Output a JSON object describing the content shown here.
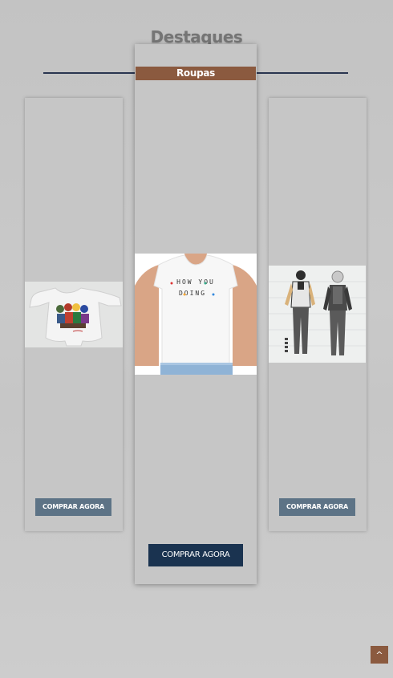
{
  "section": {
    "title": "Destaques",
    "category_tag": "Roupas"
  },
  "products": [
    {
      "position": "left",
      "image": "baby-bodysuit-with-cartoon-characters",
      "button_label": "COMPRAR AGORA"
    },
    {
      "position": "center",
      "image": "white-tshirt-how-you-doing",
      "image_text": "HOW YOU DOING",
      "button_label": "COMPRAR AGORA"
    },
    {
      "position": "right",
      "image": "anime-character-costume-front-and-side",
      "button_label": "COMPRAR AGORA"
    }
  ],
  "scroll_top": {
    "label": "^"
  },
  "colors": {
    "background": "#c6c6c6",
    "tag": "#8b5a3f",
    "rule": "#2a3550",
    "button_small": "#5d7386",
    "button_main": "#1a3350"
  }
}
